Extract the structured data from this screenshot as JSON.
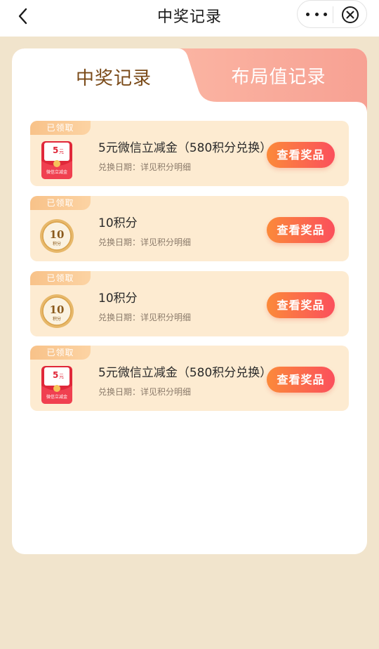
{
  "nav": {
    "title": "中奖记录"
  },
  "tabs": [
    {
      "label": "中奖记录",
      "active": true
    },
    {
      "label": "布局值记录",
      "active": false
    }
  ],
  "records": [
    {
      "tag": "已领取",
      "name": "5元微信立减金（580积分兑换）",
      "date": "兑换日期：详见积分明细",
      "button": "查看奖品",
      "thumb_type": "red-envelope",
      "thumb_amount": "5",
      "thumb_unit": "元",
      "thumb_caption": "微信立减金"
    },
    {
      "tag": "已领取",
      "name": "10积分",
      "date": "兑换日期：详见积分明细",
      "button": "查看奖品",
      "thumb_type": "coin",
      "thumb_amount": "10",
      "thumb_caption": "积分"
    },
    {
      "tag": "已领取",
      "name": "10积分",
      "date": "兑换日期：详见积分明细",
      "button": "查看奖品",
      "thumb_type": "coin",
      "thumb_amount": "10",
      "thumb_caption": "积分"
    },
    {
      "tag": "已领取",
      "name": "5元微信立减金（580积分兑换）",
      "date": "兑换日期：详见积分明细",
      "button": "查看奖品",
      "thumb_type": "red-envelope",
      "thumb_amount": "5",
      "thumb_unit": "元",
      "thumb_caption": "微信立减金"
    }
  ],
  "colors": {
    "page_bg": "#f1e4cc",
    "record_bg": "#fdebd1",
    "tab_active_text": "#7a4a18",
    "button_start": "#fb8a3a",
    "button_end": "#fb4f5c"
  }
}
